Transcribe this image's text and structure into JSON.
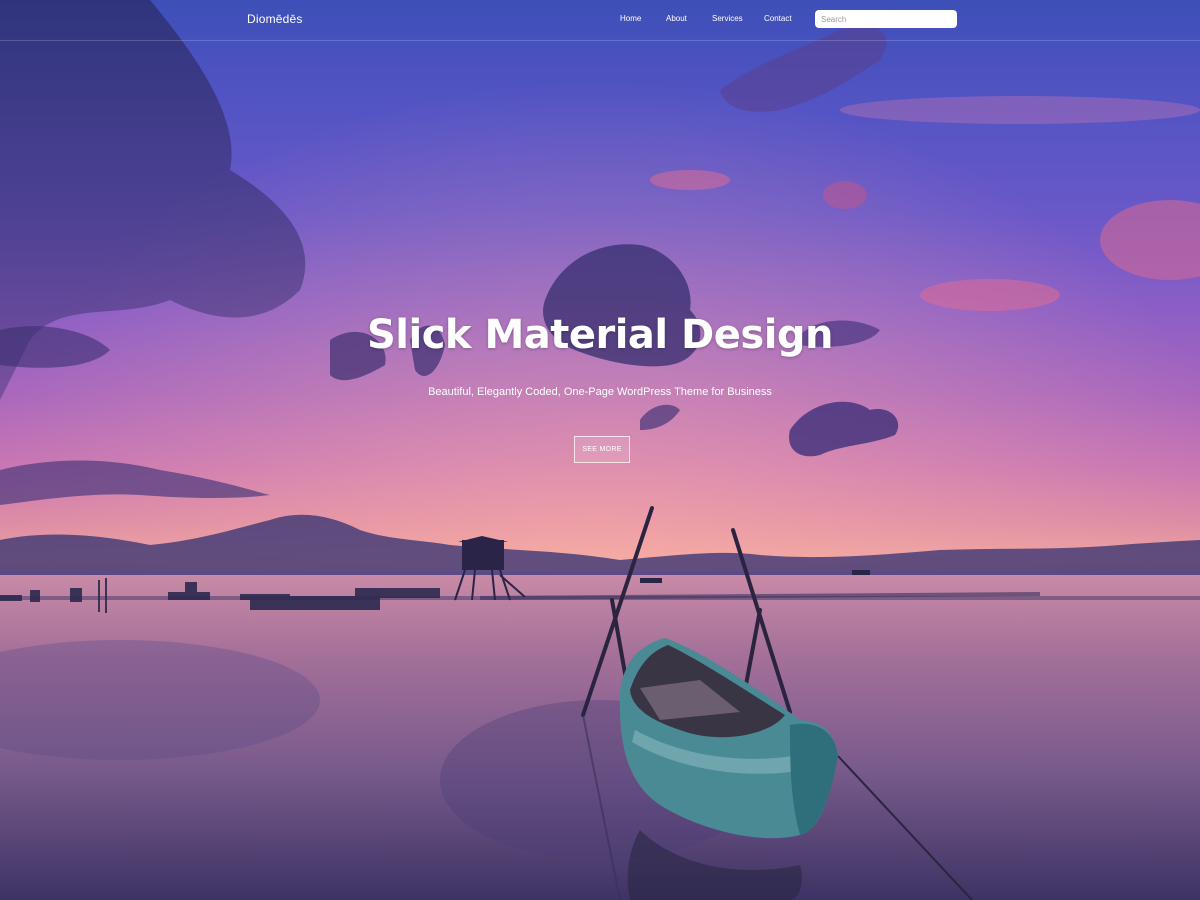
{
  "header": {
    "brand": "Diomēdēs",
    "nav": [
      {
        "label": "Home"
      },
      {
        "label": "About"
      },
      {
        "label": "Services"
      },
      {
        "label": "Contact"
      }
    ],
    "search": {
      "placeholder": "Search",
      "value": ""
    }
  },
  "hero": {
    "title": "Slick Material Design",
    "subtitle": "Beautiful, Elegantly Coded, One-Page WordPress Theme for Business",
    "button_label": "SEE MORE"
  },
  "colors": {
    "sky_top": "#3d4fb8",
    "horizon": "#e9a0a0",
    "water_bottom": "#3f3566",
    "text": "#ffffff"
  },
  "icons": []
}
